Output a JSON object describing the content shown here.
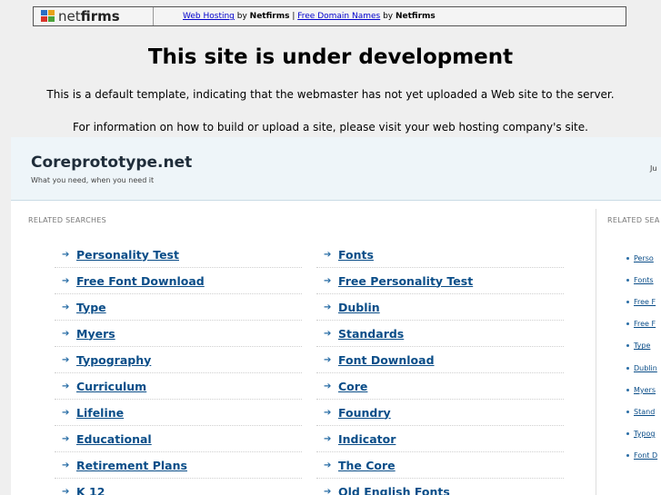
{
  "topbar": {
    "logo_text_light": "net",
    "logo_text_bold": "firms",
    "link_hosting": "Web Hosting",
    "by1": " by ",
    "brand1": "Netfirms",
    "sep": " | ",
    "link_domains": "Free Domain Names",
    "by2": " by ",
    "brand2": "Netfirms"
  },
  "heading": "This site is under development",
  "message1": "This is a default template, indicating that the webmaster has not yet uploaded a Web site to the server.",
  "message2": "For information on how to build or upload a site, please visit your web hosting company's site.",
  "parked": {
    "site_title": "Coreprototype.net",
    "tagline": "What you need, when you need it",
    "right_text": "Ju",
    "related_label": "RELATED SEARCHES",
    "related_label_side": "RELATED SEA",
    "left_col": [
      "Personality Test",
      "Free Font Download",
      "Type",
      "Myers",
      "Typography",
      "Curriculum",
      "Lifeline",
      "Educational",
      "Retirement Plans",
      "K 12"
    ],
    "right_col": [
      "Fonts",
      "Free Personality Test",
      "Dublin",
      "Standards",
      "Font Download",
      "Core",
      "Foundry",
      "Indicator",
      "The Core",
      "Old English Fonts"
    ],
    "side_col": [
      "Perso",
      "Fonts",
      "Free F",
      "Free F",
      "Type",
      "Dublin",
      "Myers",
      "Stand",
      "Typog",
      "Font D"
    ]
  },
  "colors": {
    "link": "#0a4d88",
    "header_bg": "#eef5f9",
    "page_bg": "#efefef"
  }
}
